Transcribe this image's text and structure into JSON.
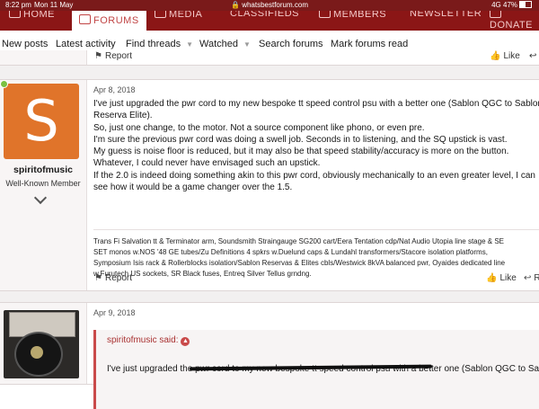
{
  "status_bar": {
    "time": "8:22 pm",
    "date": "Mon 11 May",
    "url": "whatsbestforum.com",
    "signal": "4G 47%"
  },
  "main_nav": {
    "items": [
      {
        "label": "HOME",
        "icon": "home-icon"
      },
      {
        "label": "FORUMS",
        "icon": "forums-icon",
        "active": true
      },
      {
        "label": "MEDIA",
        "icon": "media-icon"
      },
      {
        "label": "CLASSIFIEDS",
        "icon": "classifieds-icon"
      },
      {
        "label": "MEMBERS",
        "icon": "members-icon"
      },
      {
        "label": "NEWSLETTER"
      },
      {
        "label": "DONATE",
        "icon": "donate-icon"
      }
    ]
  },
  "sub_nav": {
    "new_posts": "New posts",
    "latest_activity": "Latest activity",
    "find_threads": "Find threads",
    "watched": "Watched",
    "search_forums": "Search forums",
    "mark_forums_read": "Mark forums read"
  },
  "prev_post": {
    "report": "Report",
    "like": "Like"
  },
  "post1": {
    "avatar_letter": "S",
    "avatar_color": "#e0742a",
    "username": "spiritofmusic",
    "user_title": "Well-Known Member",
    "date": "Apr 8, 2018",
    "message_lines": [
      "I've just upgraded the pwr cord to my new bespoke tt speed control psu with a better one (Sablon QGC to Sablon",
      "Reserva Elite).",
      "So, just one change, to the motor. Not a source component like phono, or even pre.",
      "I'm sure the previous pwr cord was doing a swell job. Seconds in to listening, and the SQ upstick is vast.",
      "My guess is noise floor is reduced, but it may also be that speed stability/accuracy is more on the button.",
      "Whatever, I could never have envisaged such an upstick.",
      "If the 2.0 is indeed doing something akin to this pwr cord, obviously mechanically to an even greater level, I can",
      "see how it would be a game changer over the 1.5."
    ],
    "signature_lines": [
      "Trans Fi Salvation tt & Terminator arm, Soundsmith Straingauge SG200 cart/Eera Tentation cdp/Nat Audio Utopia line stage & SE",
      "SET monos w.NOS '48 GE tubes/Zu Definitions 4 spkrs w.Duelund caps & Lundahl transformers/Stacore isolation platforms,",
      "Symposium Isis rack & Rollerblocks isolation/Sablon Reservas & Elites cbls/Westwick 8kVA balanced pwr, Oyaides dedicated line",
      "w.Furutech US sockets, SR Black fuses, Entreq Silver Tellus grndng."
    ],
    "report": "Report",
    "like": "Like",
    "reply": "R"
  },
  "post2": {
    "date": "Apr 9, 2018",
    "quote_attribution": "spiritofmusic said:",
    "quote_text": "I've just upgraded the pwr cord to my new bespoke tt speed control psu with a better one (Sablon QGC to Sablon"
  }
}
